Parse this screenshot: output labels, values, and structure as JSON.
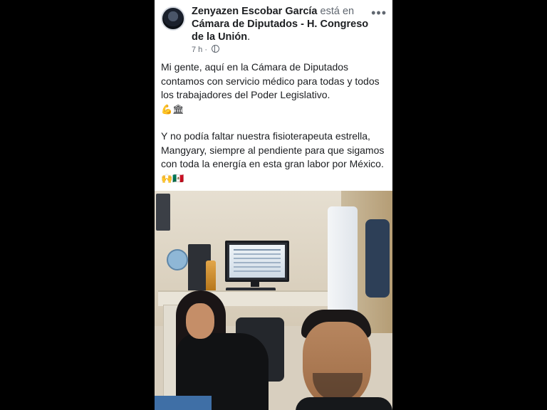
{
  "post": {
    "author": "Zenyazen Escobar García",
    "location_connector": "está en",
    "location": "Cámara de Diputados - H. Congreso de la Unión",
    "location_end": ".",
    "time": "7 h ·",
    "privacy_icon": "globe-icon",
    "more_icon": "more-options-icon",
    "more_label": "•••",
    "paragraphs": [
      "Mi gente, aquí en la Cámara de Diputados contamos con servicio médico para todas y todos los trabajadores del Poder Legislativo.",
      "Y no podía faltar nuestra fisioterapeuta estrella, Mangyary, siempre al pendiente para que sigamos con toda la energía en esta gran labor por México."
    ],
    "emojis_1": "💪🏛",
    "emojis_2": "🙌🇲🇽"
  }
}
